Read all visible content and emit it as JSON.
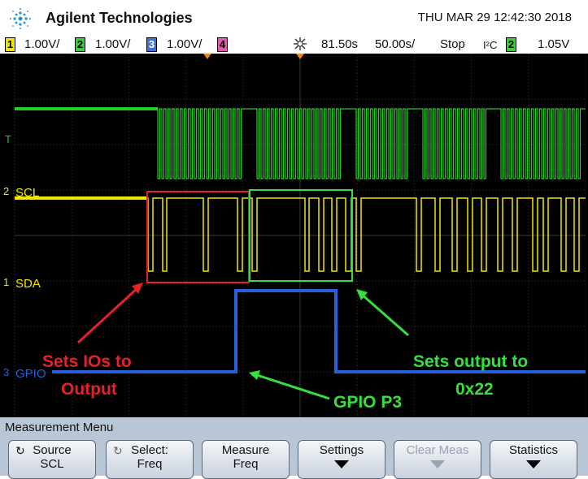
{
  "header": {
    "brand": "Agilent Technologies",
    "datetime": "THU MAR 29 12:42:30 2018"
  },
  "status_bar": {
    "ch1": {
      "num": "1",
      "scale": "1.00V/",
      "color": "#f2e600"
    },
    "ch2": {
      "num": "2",
      "scale": "1.00V/",
      "color": "#33d233"
    },
    "ch3": {
      "num": "3",
      "scale": "1.00V/",
      "color": "#3f6fe0"
    },
    "ch4": {
      "num": "4",
      "color": "#e05ab0"
    },
    "delay": "81.50s",
    "timebase": "50.00s/",
    "run_state": "Stop",
    "trigger_type": "I²C",
    "trigger_channel": "2",
    "trigger_level": "1.05V"
  },
  "traces": {
    "t_label": "T",
    "scl_label": "SCL",
    "scl_num": "2",
    "sda_label": "SDA",
    "sda_num": "1",
    "gpio_label": "GPIO",
    "gpio_num": "3"
  },
  "annotations": {
    "sets_ios_line1": "Sets IOs to",
    "sets_ios_line2": "Output",
    "gpio_p3": "GPIO P3",
    "sets_output_line1": "Sets output to",
    "sets_output_line2": "0x22"
  },
  "colors": {
    "ann_red": "#e4222a",
    "ann_green": "#34e03c",
    "trace_green": "#22d022",
    "trace_yellow": "#f2e600",
    "trace_blue": "#2a5fdc"
  },
  "menu": {
    "title": "Measurement Menu",
    "keys": [
      {
        "line1": "Source",
        "line2": "SCL",
        "icon": "rotate-icon"
      },
      {
        "line1": "Select:",
        "line2": "Freq",
        "icon": "rotate-icon"
      },
      {
        "line1": "Measure",
        "line2": "Freq"
      },
      {
        "line1": "Settings",
        "arrow": true
      },
      {
        "line1": "Clear Meas",
        "arrow": true,
        "disabled": true
      },
      {
        "line1": "Statistics",
        "arrow": true
      }
    ]
  }
}
